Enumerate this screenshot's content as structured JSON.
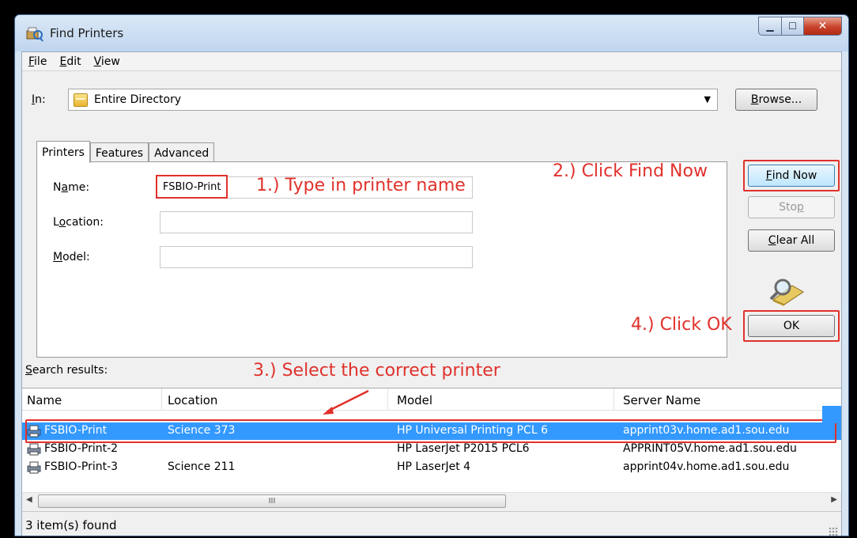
{
  "window": {
    "title": "Find Printers"
  },
  "menu": [
    "File",
    "Edit",
    "View"
  ],
  "in_row": {
    "label": "In:",
    "value": "Entire Directory"
  },
  "buttons": {
    "browse": "Browse...",
    "find_now": "Find Now",
    "stop": "Stop",
    "clear_all": "Clear All",
    "ok": "OK"
  },
  "tabs": [
    "Printers",
    "Features",
    "Advanced"
  ],
  "form": {
    "name_label": "Name:",
    "name_value": "FSBIO-Print",
    "location_label": "Location:",
    "location_value": "",
    "model_label": "Model:",
    "model_value": ""
  },
  "annotations": {
    "step1": "1.) Type in printer name",
    "step2": "2.) Click Find Now",
    "step3": "3.) Select the correct printer",
    "step4": "4.) Click OK"
  },
  "results": {
    "label": "Search results:",
    "columns": [
      "Name",
      "Location",
      "Model",
      "Server Name"
    ],
    "rows": [
      {
        "name": "FSBIO-Print",
        "location": "Science 373",
        "model": "HP Universal Printing PCL 6",
        "server": "apprint03v.home.ad1.sou.edu",
        "selected": true
      },
      {
        "name": "FSBIO-Print-2",
        "location": "",
        "model": "HP LaserJet P2015 PCL6",
        "server": "APPRINT05V.home.ad1.sou.edu",
        "selected": false
      },
      {
        "name": "FSBIO-Print-3",
        "location": "Science 211",
        "model": "HP LaserJet 4",
        "server": "apprint04v.home.ad1.sou.edu",
        "selected": false
      }
    ]
  },
  "scrollbar": {
    "thumb_grip": "III"
  },
  "status": "3 item(s) found",
  "colors": {
    "annotation": "#e0312c",
    "selection": "#3399ff"
  },
  "icons": [
    "find-printers-icon",
    "folder-icon",
    "search-printer-icon",
    "printer-icon"
  ]
}
